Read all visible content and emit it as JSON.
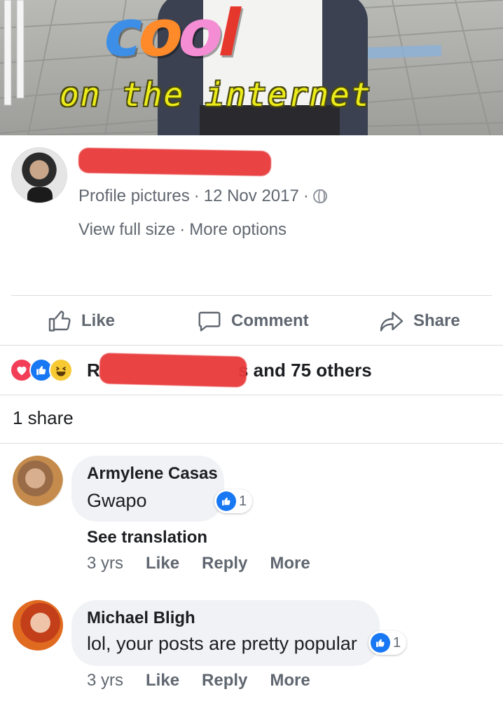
{
  "photo": {
    "meme_title": "cool",
    "meme_subtitle": "on the internet",
    "meme_colors": [
      "#3d8ee6",
      "#ff8a2a",
      "#f58dd4",
      "#e6372d"
    ]
  },
  "post": {
    "meta": {
      "album": "Profile pictures",
      "separator": "·",
      "date": "12 Nov 2017",
      "privacy_icon": "globe-icon"
    },
    "links": {
      "view_full_size": "View full size",
      "separator": "·",
      "more_options": "More options"
    }
  },
  "actions": {
    "like": "Like",
    "comment": "Comment",
    "share": "Share"
  },
  "reactions": {
    "icons": [
      "love-reaction-icon",
      "like-reaction-icon",
      "haha-reaction-icon"
    ],
    "text_first": "R",
    "text_rest": "s and 75 others"
  },
  "shares": {
    "label": "1 share"
  },
  "comments": [
    {
      "author": "Armylene Casas",
      "text": "Gwapo",
      "likes": "1",
      "see_translation": "See translation",
      "time": "3 yrs",
      "like": "Like",
      "reply": "Reply",
      "more": "More"
    },
    {
      "author": "Michael Bligh",
      "text": "lol, your posts are pretty popular",
      "likes": "1",
      "time": "3 yrs",
      "like": "Like",
      "reply": "Reply",
      "more": "More"
    }
  ],
  "colors": {
    "accent": "#1877f2",
    "redaction": "#e8393a",
    "secondary_text": "#616770"
  }
}
